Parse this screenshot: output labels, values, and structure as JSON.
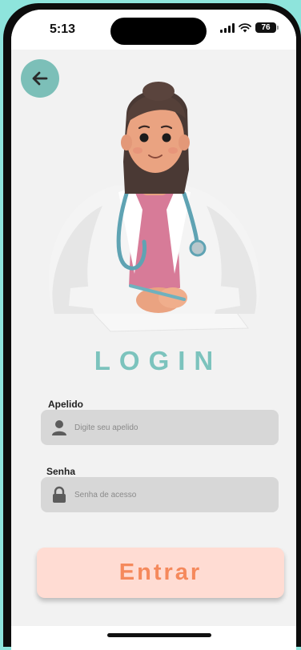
{
  "status_bar": {
    "time": "5:13",
    "battery": "76"
  },
  "icons": {
    "back": "arrow-left-icon",
    "user": "user-icon",
    "lock": "lock-icon"
  },
  "title": "LOGIN",
  "form": {
    "nickname_label": "Apelido",
    "nickname_placeholder": "Digite seu apelido",
    "password_label": "Senha",
    "password_placeholder": "Senha de acesso",
    "submit_label": "Entrar"
  },
  "colors": {
    "accent_teal": "#7cc3bd",
    "button_bg": "#ffdcd3",
    "button_text": "#f5895c",
    "outer_bg": "#8ee4dc"
  }
}
